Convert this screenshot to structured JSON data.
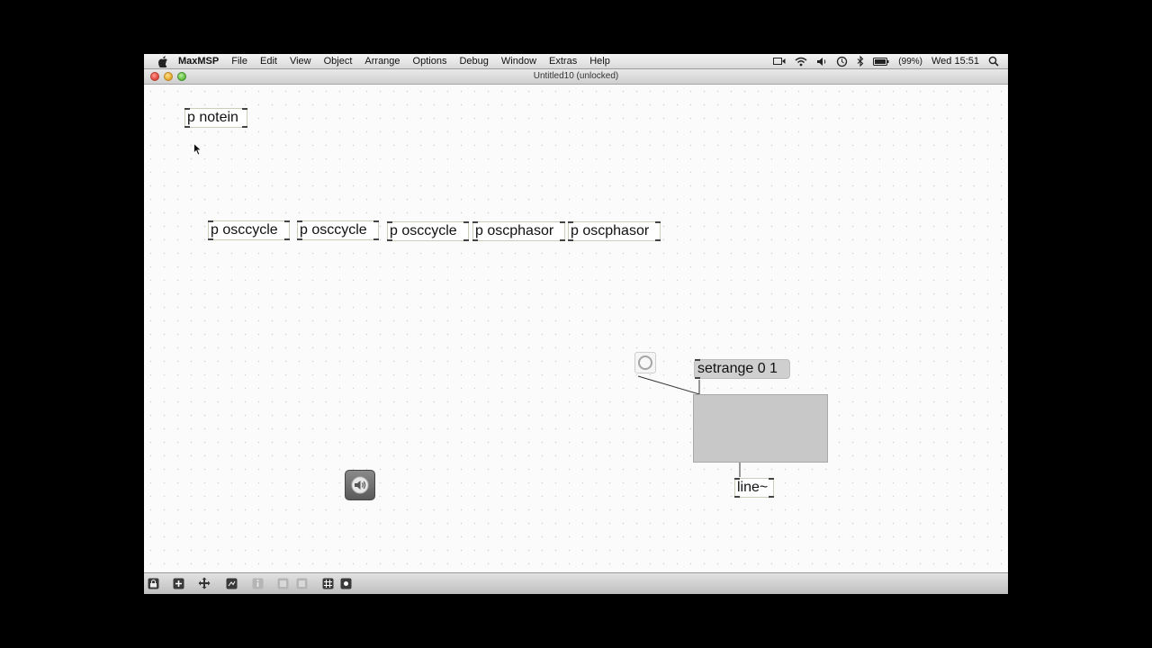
{
  "menubar": {
    "app_name": "MaxMSP",
    "items": [
      "File",
      "Edit",
      "View",
      "Object",
      "Arrange",
      "Options",
      "Debug",
      "Window",
      "Extras",
      "Help"
    ],
    "battery": "(99%)",
    "clock": "Wed 15:51"
  },
  "window": {
    "title": "Untitled10 (unlocked)"
  },
  "patcher": {
    "objects": {
      "notein": "p notein",
      "osccycle_1": "p osccycle",
      "osccycle_2": "p osccycle",
      "osccycle_3": "p osccycle",
      "oscphasor_1": "p oscphasor",
      "oscphasor_2": "p oscphasor",
      "line": "line~"
    },
    "message_setrange": "setrange 0 1"
  },
  "toolbar": {
    "buttons": [
      "lock-icon",
      "new-object-icon",
      "move-icon",
      "presentation-icon",
      "info-icon",
      "align-icon",
      "distribute-icon",
      "grid-icon",
      "snap-icon"
    ]
  },
  "colors": {
    "background": "#fafafa",
    "object_border": "#c9cfb8",
    "message_box": "#cfcfcf"
  }
}
